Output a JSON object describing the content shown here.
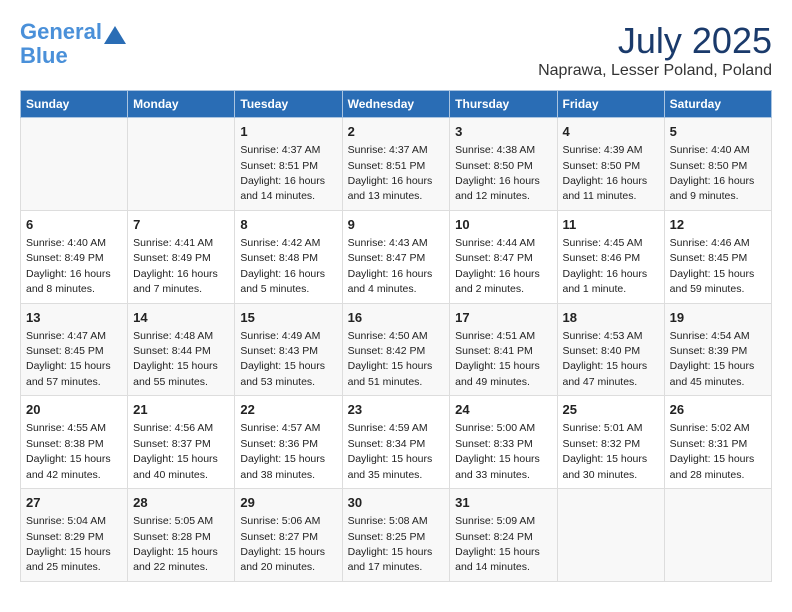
{
  "logo": {
    "line1": "General",
    "line2": "Blue"
  },
  "title": "July 2025",
  "subtitle": "Naprawa, Lesser Poland, Poland",
  "weekdays": [
    "Sunday",
    "Monday",
    "Tuesday",
    "Wednesday",
    "Thursday",
    "Friday",
    "Saturday"
  ],
  "weeks": [
    [
      {
        "day": "",
        "info": ""
      },
      {
        "day": "",
        "info": ""
      },
      {
        "day": "1",
        "info": "Sunrise: 4:37 AM\nSunset: 8:51 PM\nDaylight: 16 hours and 14 minutes."
      },
      {
        "day": "2",
        "info": "Sunrise: 4:37 AM\nSunset: 8:51 PM\nDaylight: 16 hours and 13 minutes."
      },
      {
        "day": "3",
        "info": "Sunrise: 4:38 AM\nSunset: 8:50 PM\nDaylight: 16 hours and 12 minutes."
      },
      {
        "day": "4",
        "info": "Sunrise: 4:39 AM\nSunset: 8:50 PM\nDaylight: 16 hours and 11 minutes."
      },
      {
        "day": "5",
        "info": "Sunrise: 4:40 AM\nSunset: 8:50 PM\nDaylight: 16 hours and 9 minutes."
      }
    ],
    [
      {
        "day": "6",
        "info": "Sunrise: 4:40 AM\nSunset: 8:49 PM\nDaylight: 16 hours and 8 minutes."
      },
      {
        "day": "7",
        "info": "Sunrise: 4:41 AM\nSunset: 8:49 PM\nDaylight: 16 hours and 7 minutes."
      },
      {
        "day": "8",
        "info": "Sunrise: 4:42 AM\nSunset: 8:48 PM\nDaylight: 16 hours and 5 minutes."
      },
      {
        "day": "9",
        "info": "Sunrise: 4:43 AM\nSunset: 8:47 PM\nDaylight: 16 hours and 4 minutes."
      },
      {
        "day": "10",
        "info": "Sunrise: 4:44 AM\nSunset: 8:47 PM\nDaylight: 16 hours and 2 minutes."
      },
      {
        "day": "11",
        "info": "Sunrise: 4:45 AM\nSunset: 8:46 PM\nDaylight: 16 hours and 1 minute."
      },
      {
        "day": "12",
        "info": "Sunrise: 4:46 AM\nSunset: 8:45 PM\nDaylight: 15 hours and 59 minutes."
      }
    ],
    [
      {
        "day": "13",
        "info": "Sunrise: 4:47 AM\nSunset: 8:45 PM\nDaylight: 15 hours and 57 minutes."
      },
      {
        "day": "14",
        "info": "Sunrise: 4:48 AM\nSunset: 8:44 PM\nDaylight: 15 hours and 55 minutes."
      },
      {
        "day": "15",
        "info": "Sunrise: 4:49 AM\nSunset: 8:43 PM\nDaylight: 15 hours and 53 minutes."
      },
      {
        "day": "16",
        "info": "Sunrise: 4:50 AM\nSunset: 8:42 PM\nDaylight: 15 hours and 51 minutes."
      },
      {
        "day": "17",
        "info": "Sunrise: 4:51 AM\nSunset: 8:41 PM\nDaylight: 15 hours and 49 minutes."
      },
      {
        "day": "18",
        "info": "Sunrise: 4:53 AM\nSunset: 8:40 PM\nDaylight: 15 hours and 47 minutes."
      },
      {
        "day": "19",
        "info": "Sunrise: 4:54 AM\nSunset: 8:39 PM\nDaylight: 15 hours and 45 minutes."
      }
    ],
    [
      {
        "day": "20",
        "info": "Sunrise: 4:55 AM\nSunset: 8:38 PM\nDaylight: 15 hours and 42 minutes."
      },
      {
        "day": "21",
        "info": "Sunrise: 4:56 AM\nSunset: 8:37 PM\nDaylight: 15 hours and 40 minutes."
      },
      {
        "day": "22",
        "info": "Sunrise: 4:57 AM\nSunset: 8:36 PM\nDaylight: 15 hours and 38 minutes."
      },
      {
        "day": "23",
        "info": "Sunrise: 4:59 AM\nSunset: 8:34 PM\nDaylight: 15 hours and 35 minutes."
      },
      {
        "day": "24",
        "info": "Sunrise: 5:00 AM\nSunset: 8:33 PM\nDaylight: 15 hours and 33 minutes."
      },
      {
        "day": "25",
        "info": "Sunrise: 5:01 AM\nSunset: 8:32 PM\nDaylight: 15 hours and 30 minutes."
      },
      {
        "day": "26",
        "info": "Sunrise: 5:02 AM\nSunset: 8:31 PM\nDaylight: 15 hours and 28 minutes."
      }
    ],
    [
      {
        "day": "27",
        "info": "Sunrise: 5:04 AM\nSunset: 8:29 PM\nDaylight: 15 hours and 25 minutes."
      },
      {
        "day": "28",
        "info": "Sunrise: 5:05 AM\nSunset: 8:28 PM\nDaylight: 15 hours and 22 minutes."
      },
      {
        "day": "29",
        "info": "Sunrise: 5:06 AM\nSunset: 8:27 PM\nDaylight: 15 hours and 20 minutes."
      },
      {
        "day": "30",
        "info": "Sunrise: 5:08 AM\nSunset: 8:25 PM\nDaylight: 15 hours and 17 minutes."
      },
      {
        "day": "31",
        "info": "Sunrise: 5:09 AM\nSunset: 8:24 PM\nDaylight: 15 hours and 14 minutes."
      },
      {
        "day": "",
        "info": ""
      },
      {
        "day": "",
        "info": ""
      }
    ]
  ]
}
